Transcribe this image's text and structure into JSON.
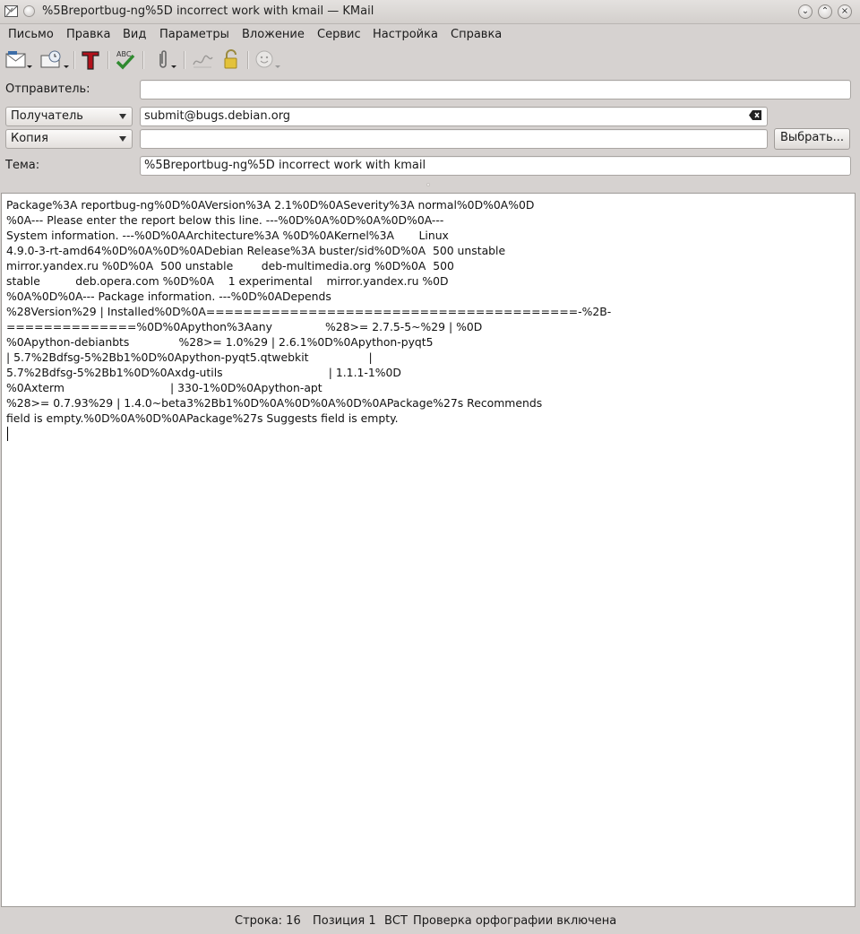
{
  "window": {
    "title": "%5Breportbug-ng%5D incorrect work with kmail — KMail"
  },
  "menu": [
    {
      "label": "Письмо",
      "key": "menu-pismo"
    },
    {
      "label": "Правка",
      "key": "menu-pravka"
    },
    {
      "label": "Вид",
      "key": "menu-vid"
    },
    {
      "label": "Параметры",
      "key": "menu-parametry"
    },
    {
      "label": "Вложение",
      "key": "menu-vlozhenie"
    },
    {
      "label": "Сервис",
      "key": "menu-servis"
    },
    {
      "label": "Настройка",
      "key": "menu-nastroyka"
    },
    {
      "label": "Справка",
      "key": "menu-spravka"
    }
  ],
  "toolbar": {
    "icons": [
      "send-mail-icon",
      "send-later-icon",
      "text-format-icon",
      "spellcheck-icon",
      "attach-icon",
      "sign-icon",
      "encrypt-icon",
      "emoticon-icon"
    ]
  },
  "header": {
    "from_label": "Отправитель:",
    "from_value": "",
    "to_type": "Получатель",
    "to_value": "submit@bugs.debian.org",
    "cc_type": "Копия",
    "cc_value": "",
    "select_button": "Выбрать...",
    "subject_label": "Тема:",
    "subject_value": "%5Breportbug-ng%5D incorrect work with kmail"
  },
  "body": {
    "lines": [
      "Package%3A reportbug-ng%0D%0AVersion%3A 2.1%0D%0ASeverity%3A normal%0D%0A%0D",
      "%0A--- Please enter the report below this line. ---%0D%0A%0D%0A%0D%0A---",
      "System information. ---%0D%0AArchitecture%3A %0D%0AKernel%3A       Linux",
      "4.9.0-3-rt-amd64%0D%0A%0D%0ADebian Release%3A buster/sid%0D%0A  500 unstable",
      "mirror.yandex.ru %0D%0A  500 unstable        deb-multimedia.org %0D%0A  500",
      "stable          deb.opera.com %0D%0A    1 experimental    mirror.yandex.ru %0D",
      "%0A%0D%0A--- Package information. ---%0D%0ADepends",
      "%28Version%29 | Installed%0D%0A========================================-%2B-",
      "==============%0D%0Apython%3Aany               %28>= 2.7.5-5~%29 | %0D",
      "%0Apython-debianbts              %28>= 1.0%29 | 2.6.1%0D%0Apython-pyqt5",
      "| 5.7%2Bdfsg-5%2Bb1%0D%0Apython-pyqt5.qtwebkit                 |",
      "5.7%2Bdfsg-5%2Bb1%0D%0Axdg-utils                              | 1.1.1-1%0D",
      "%0Axterm                              | 330-1%0D%0Apython-apt",
      "%28>= 0.7.93%29 | 1.4.0~beta3%2Bb1%0D%0A%0D%0A%0D%0APackage%27s Recommends",
      "field is empty.%0D%0A%0D%0APackage%27s Suggests field is empty."
    ]
  },
  "status": {
    "line": "Строка: 16",
    "position": "Позиция 1",
    "mode": "ВСТ",
    "spell": "Проверка орфографии включена"
  }
}
